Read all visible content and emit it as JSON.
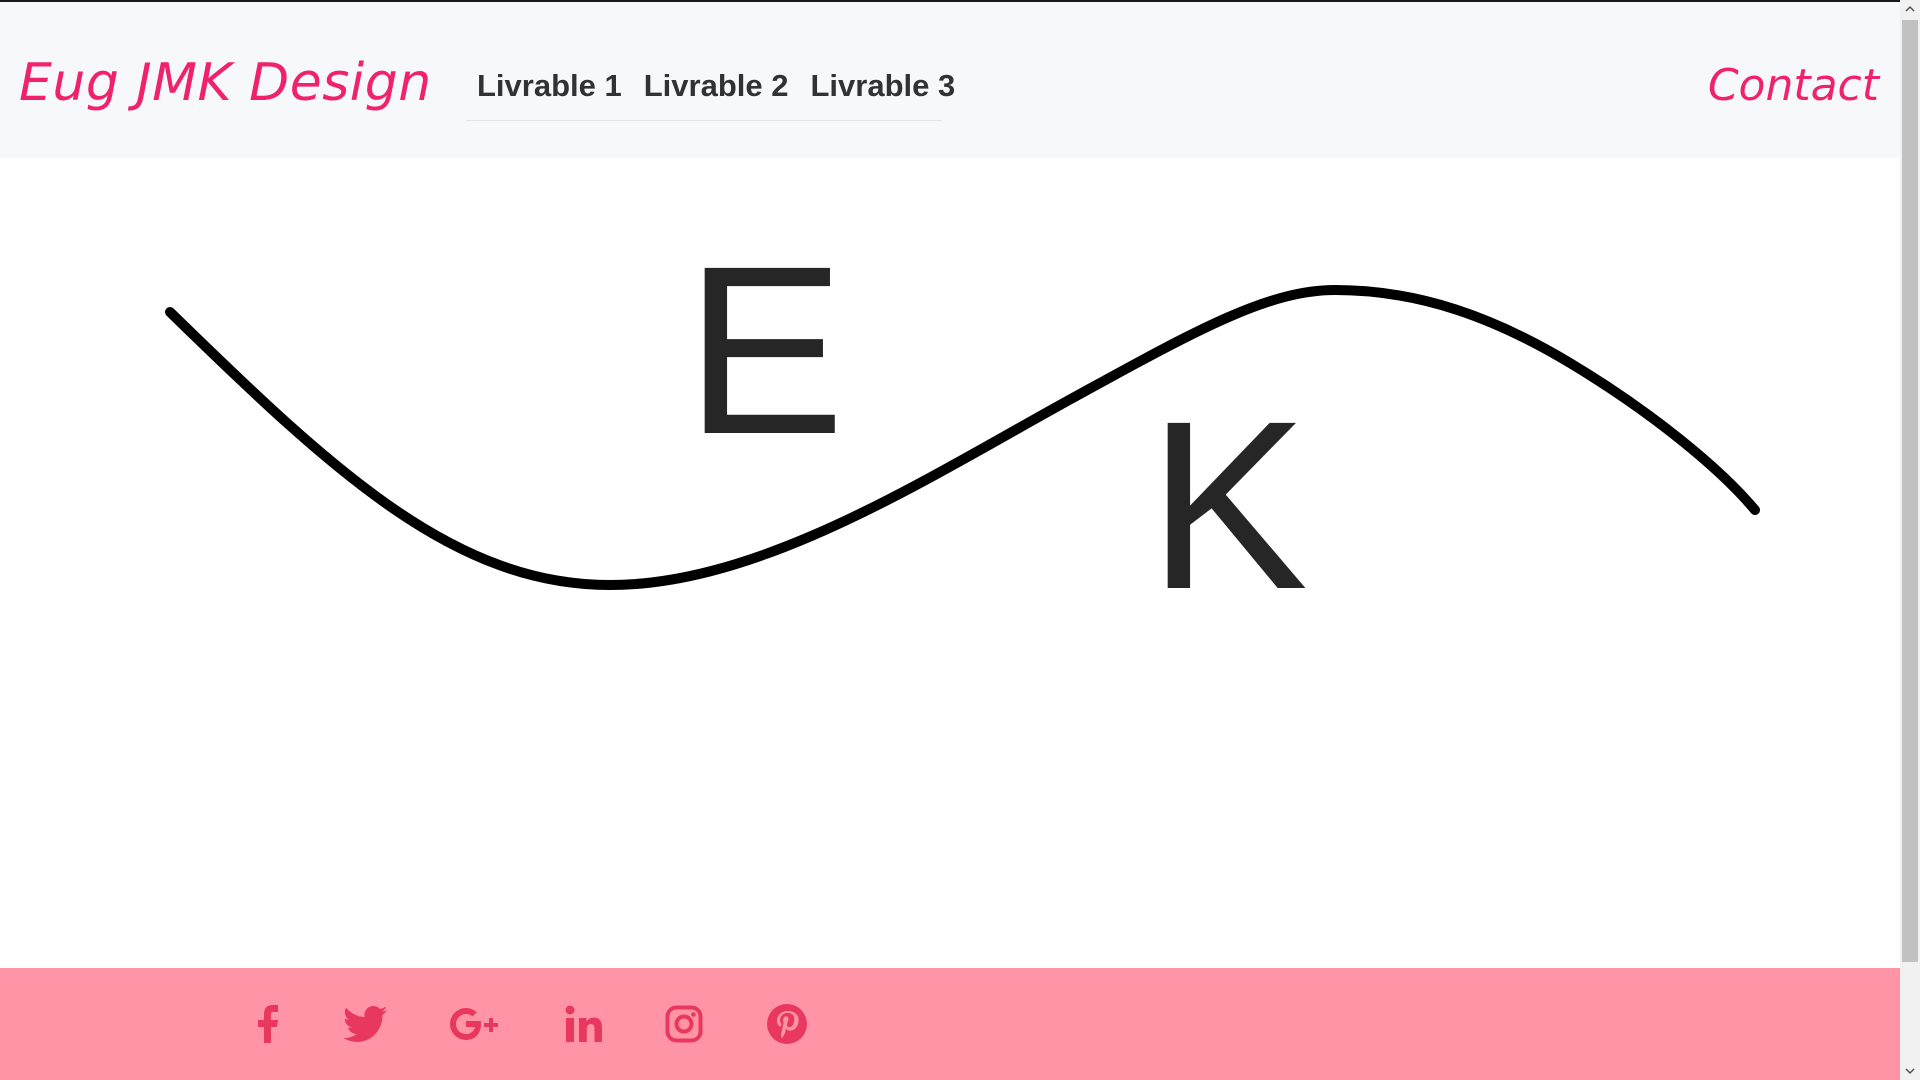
{
  "navbar": {
    "brand": "Eug JMK Design",
    "links": [
      {
        "label": "Livrable 1"
      },
      {
        "label": "Livrable 2"
      },
      {
        "label": "Livrable 3"
      }
    ],
    "contact": "Contact"
  },
  "hero": {
    "letter_e": "E",
    "letter_k": "K"
  },
  "footer": {
    "social_icons": [
      "facebook-icon",
      "twitter-icon",
      "google-plus-icon",
      "linkedin-icon",
      "instagram-icon",
      "pinterest-icon"
    ]
  },
  "colors": {
    "brand": "#f0226c",
    "navbar_bg": "#f7f8f9",
    "nav_text": "#2f3336",
    "footer_bg": "#ff94a6",
    "social_icon": "#e8385f",
    "hero_ink": "#000000",
    "hero_letters": "#262626"
  }
}
